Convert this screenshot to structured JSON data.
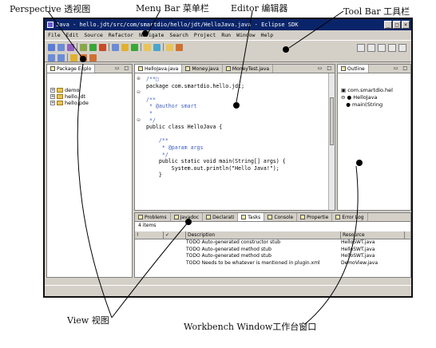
{
  "callouts": {
    "perspective": "Perspective 透视图",
    "menubar": "Menu Bar 菜单栏",
    "editor": "Editor 编辑器",
    "toolbar": "Tool Bar 工具栏",
    "view": "View 视图",
    "workbench": "Workbench Window工作台窗口"
  },
  "window": {
    "title": "Java - hello.jdt/src/com/smartdio/hello/jdt/HelloJava.java - Eclipse SDK",
    "controls": [
      "_",
      "□",
      "×"
    ]
  },
  "menu": [
    "File",
    "Edit",
    "Source",
    "Refactor",
    "Navigate",
    "Search",
    "Project",
    "Run",
    "Window",
    "Help"
  ],
  "toolbar": {
    "icon_colors": [
      "#5a7bd6",
      "#8aa64a",
      "#3aa63a",
      "#c84a2a",
      "#6b8bd6",
      "#e0b030",
      "#4aa6c8",
      "#d07030",
      "#9060c0",
      "#e8c45a"
    ]
  },
  "package_explorer": {
    "tab": "Package Explo",
    "items": [
      "demo",
      "hello.jdt",
      "hello.pde"
    ]
  },
  "editor": {
    "tabs": [
      "HelloJava.java",
      "Money.java",
      "MoneyTest.java"
    ],
    "code": [
      "/**□",
      "package com.smartdio.hello.jdt;",
      "",
      "/**",
      " * @author smart",
      " *",
      " */",
      "public class HelloJava {",
      "",
      "    /**",
      "     * @param args",
      "     */",
      "    public static void main(String[] args) {",
      "        System.out.println(\"Hello Java!\");",
      "    }"
    ]
  },
  "outline": {
    "tab": "Outline",
    "items": [
      "com.smartdio.hel",
      "HelloJava",
      "main(String"
    ]
  },
  "tasks": {
    "tabs": [
      "Problems",
      "Javadoc",
      "Declarati",
      "Tasks",
      "Console",
      "Propertie",
      "Error Log"
    ],
    "count": "4 items",
    "headers": [
      "!",
      "✓",
      "Description",
      "Resource"
    ],
    "rows": [
      [
        "TODO Auto-generated constructor stub",
        "HelloSWT.java"
      ],
      [
        "TODO Auto-generated method stub",
        "HelloSWT.java"
      ],
      [
        "TODO Auto-generated method stub",
        "HelloSWT.java"
      ],
      [
        "TODO Needs to be whatever is mentioned in plugin.xml",
        "DemoView.java"
      ]
    ]
  }
}
